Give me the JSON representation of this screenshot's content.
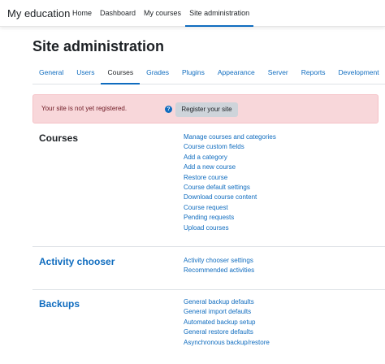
{
  "brand": "My education",
  "topnav": [
    {
      "label": "Home"
    },
    {
      "label": "Dashboard"
    },
    {
      "label": "My courses"
    },
    {
      "label": "Site administration"
    }
  ],
  "page_title": "Site administration",
  "tabs": [
    {
      "label": "General"
    },
    {
      "label": "Users"
    },
    {
      "label": "Courses"
    },
    {
      "label": "Grades"
    },
    {
      "label": "Plugins"
    },
    {
      "label": "Appearance"
    },
    {
      "label": "Server"
    },
    {
      "label": "Reports"
    },
    {
      "label": "Development"
    }
  ],
  "active_tab": "Courses",
  "alert": {
    "text": "Your site is not yet registered.",
    "help_icon": "?",
    "button": "Register your site"
  },
  "sections": [
    {
      "title": "Courses",
      "links": [
        "Manage courses and categories",
        "Course custom fields",
        "Add a category",
        "Add a new course",
        "Restore course",
        "Course default settings",
        "Download course content",
        "Course request",
        "Pending requests",
        "Upload courses"
      ]
    },
    {
      "title": "Activity chooser",
      "links": [
        "Activity chooser settings",
        "Recommended activities"
      ]
    },
    {
      "title": "Backups",
      "links": [
        "General backup defaults",
        "General import defaults",
        "Automated backup setup",
        "General restore defaults",
        "Asynchronous backup/restore"
      ]
    }
  ],
  "colors": {
    "link": "#0f6cbf",
    "alert_bg": "#f8d7da",
    "button_bg": "#ced4da"
  }
}
